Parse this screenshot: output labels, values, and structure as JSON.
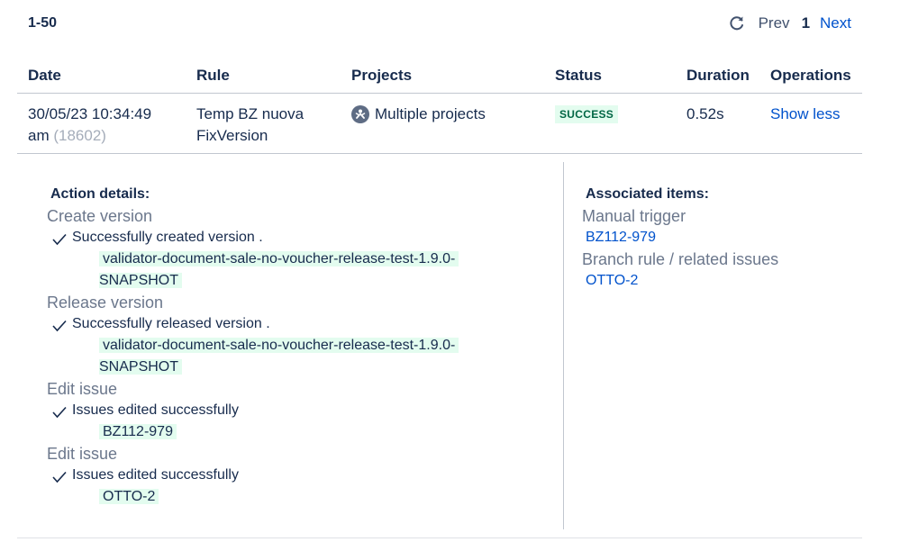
{
  "pager": {
    "range": "1-50",
    "prev": "Prev",
    "page": "1",
    "next": "Next"
  },
  "columns": [
    "Date",
    "Rule",
    "Projects",
    "Status",
    "Duration",
    "Operations"
  ],
  "row": {
    "date_line1": "30/05/23 10:34:49",
    "date_line2": "am",
    "id": "(18602)",
    "rule_line1": "Temp BZ nuova",
    "rule_line2": "FixVersion",
    "projects": "Multiple projects",
    "status": "SUCCESS",
    "duration": "0.52s",
    "operation": "Show less"
  },
  "details": {
    "title": "Action details:",
    "actions": [
      {
        "title": "Create version",
        "message": "Successfully created version .",
        "code1": "validator-document-sale-no-voucher-release-test-1.9.0-",
        "code2": "SNAPSHOT"
      },
      {
        "title": "Release version",
        "message": "Successfully released version .",
        "code1": "validator-document-sale-no-voucher-release-test-1.9.0-",
        "code2": "SNAPSHOT"
      },
      {
        "title": "Edit issue",
        "message": "Issues edited successfully",
        "code1": "BZ112-979"
      },
      {
        "title": "Edit issue",
        "message": "Issues edited successfully",
        "code1": "OTTO-2"
      }
    ]
  },
  "associated": {
    "title": "Associated items:",
    "groups": [
      {
        "title": "Manual trigger",
        "link": "BZ112-979"
      },
      {
        "title": "Branch rule / related issues",
        "link": "OTTO-2"
      }
    ]
  },
  "colors": {
    "link": "#0052cc",
    "success_bg": "#e3fcef",
    "success_text": "#006644"
  }
}
